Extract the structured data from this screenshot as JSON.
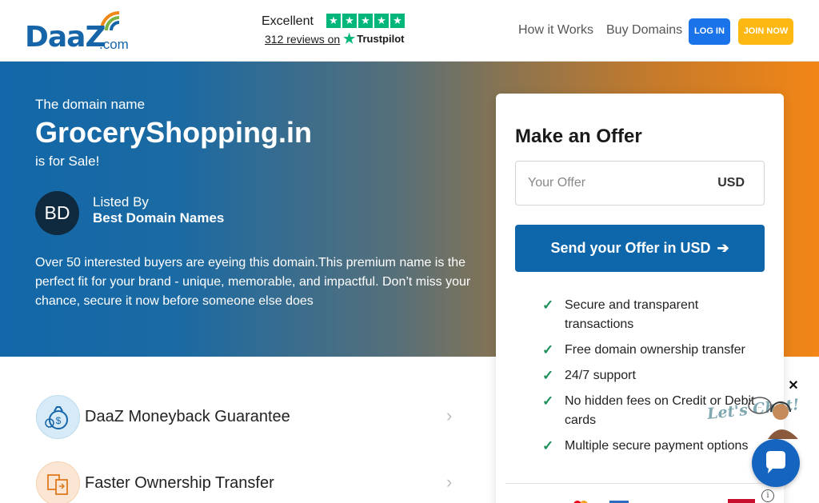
{
  "header": {
    "logo_text": "DaaZ",
    "logo_suffix": ".com",
    "trust": {
      "rating_label": "Excellent",
      "reviews_text": "312 reviews on",
      "provider": "Trustpilot"
    },
    "nav": {
      "how_it_works": "How it Works",
      "buy_domains": "Buy Domains",
      "login": "LOG IN",
      "join": "JOIN NOW"
    }
  },
  "hero": {
    "pre_title": "The domain name",
    "domain": "GroceryShopping.in",
    "post_title": "is for Sale!",
    "seller": {
      "initials": "BD",
      "label": "Listed By",
      "name": "Best Domain Names"
    },
    "description": "Over 50 interested buyers are eyeing this domain.This premium name is the perfect fit for your brand - unique, memorable, and impactful. Don’t miss your chance, secure it now before someone else does"
  },
  "features": [
    {
      "label": "DaaZ Moneyback Guarantee",
      "icon": "moneybag-icon"
    },
    {
      "label": "Faster Ownership Transfer",
      "icon": "transfer-document-icon"
    }
  ],
  "offer_card": {
    "title": "Make an Offer",
    "input_placeholder": "Your Offer",
    "currency": "USD",
    "submit_label": "Send your Offer in USD",
    "benefits": [
      "Secure and transparent transactions",
      "Free domain ownership transfer",
      "24/7 support",
      "No hidden fees on Credit or Debit cards",
      "Multiple secure payment options"
    ]
  },
  "chat": {
    "text": "Let's Chat!",
    "close_glyph": "✕",
    "info_glyph": "i"
  },
  "colors": {
    "brand_blue": "#1565a8",
    "login_blue": "#1a73e8",
    "join_yellow": "#fdb813",
    "hero_start": "#1268a8",
    "hero_end": "#f28616",
    "trustpilot_green": "#00b67a",
    "check_green": "#1e8e5a",
    "send_button": "#0f67ab"
  }
}
